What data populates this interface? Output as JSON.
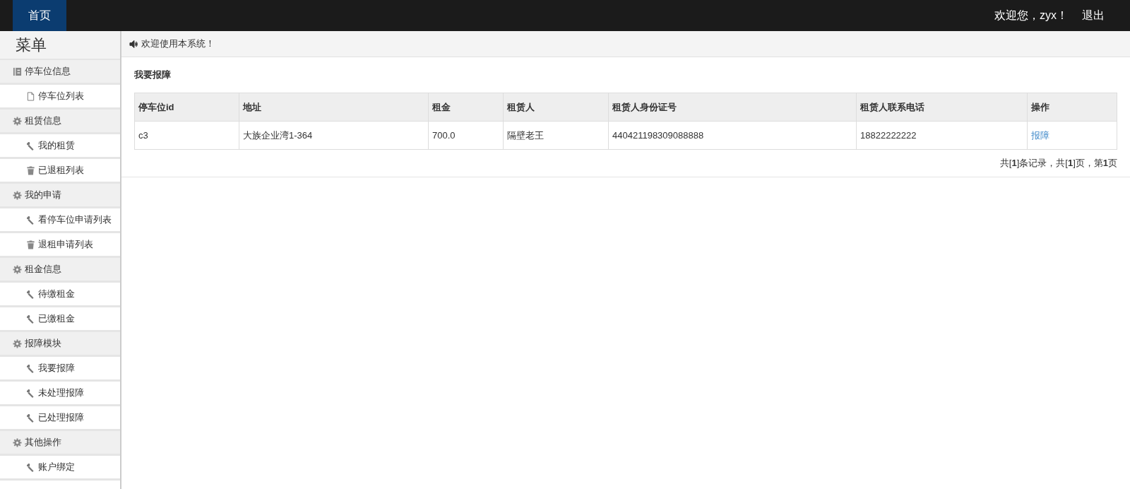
{
  "navbar": {
    "tabs": [
      {
        "label": "首页",
        "selected": true
      }
    ],
    "greeting": "欢迎您，zyx！",
    "logout": "退出"
  },
  "sidebar": {
    "title": "菜单",
    "groups": [
      {
        "label": "停车位信息",
        "kind": "card",
        "items": [
          {
            "label": "停车位列表",
            "kind": "file"
          }
        ]
      },
      {
        "label": "租赁信息",
        "kind": "gear",
        "items": [
          {
            "label": "我的租赁",
            "kind": "wrench"
          },
          {
            "label": "已退租列表",
            "kind": "trash"
          }
        ]
      },
      {
        "label": "我的申请",
        "kind": "gear",
        "items": [
          {
            "label": "看停车位申请列表",
            "kind": "wrench"
          },
          {
            "label": "退租申请列表",
            "kind": "trash"
          }
        ]
      },
      {
        "label": "租金信息",
        "kind": "gear",
        "items": [
          {
            "label": "待缴租金",
            "kind": "wrench"
          },
          {
            "label": "已缴租金",
            "kind": "wrench"
          }
        ]
      },
      {
        "label": "报障模块",
        "kind": "gear",
        "items": [
          {
            "label": "我要报障",
            "kind": "wrench"
          },
          {
            "label": "未处理报障",
            "kind": "wrench"
          },
          {
            "label": "已处理报障",
            "kind": "wrench"
          }
        ]
      },
      {
        "label": "其他操作",
        "kind": "gear",
        "items": [
          {
            "label": "账户绑定",
            "kind": "wrench"
          }
        ]
      }
    ]
  },
  "notice": "欢迎使用本系统！",
  "section_title": "我要报障",
  "table": {
    "columns": [
      "停车位id",
      "地址",
      "租金",
      "租赁人",
      "租赁人身份证号",
      "租赁人联系电话",
      "操作"
    ],
    "rows": [
      {
        "cells": [
          "c3",
          "大族企业湾1-364",
          "700.0",
          "隔壁老王",
          "440421198309088888",
          "18822222222"
        ],
        "action": "报障"
      }
    ]
  },
  "pagination": "共[**1**]条记录，共[**1**]页，第**1**页"
}
